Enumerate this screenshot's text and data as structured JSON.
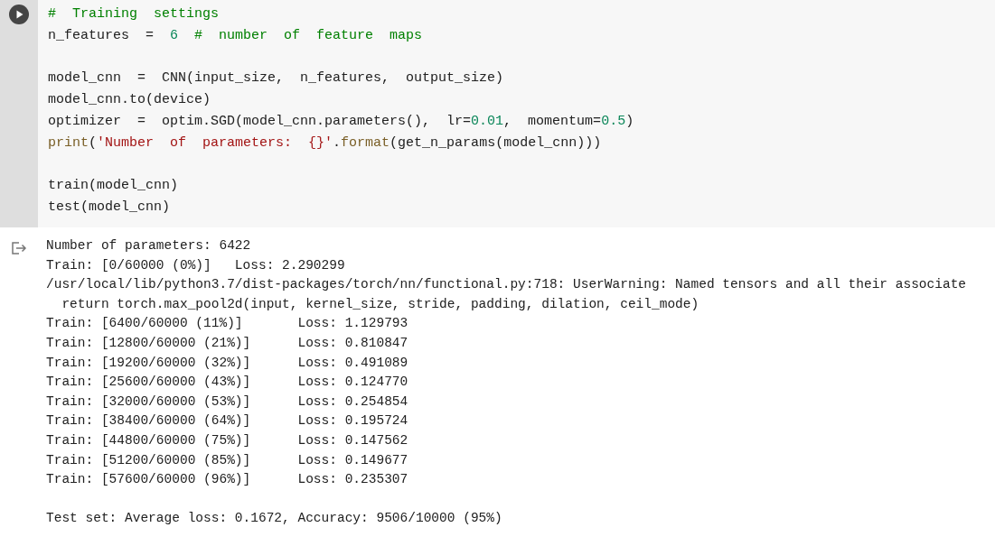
{
  "code_cell": {
    "blocks": [
      [
        [
          {
            "kind": "comment",
            "text": "#  Training  settings"
          }
        ],
        [
          {
            "kind": "plain",
            "text": "n_features  =  "
          },
          {
            "kind": "number",
            "text": "6"
          },
          {
            "kind": "comment",
            "text": "  #  number  of  feature  maps"
          }
        ]
      ],
      [
        [
          {
            "kind": "plain",
            "text": "model_cnn  =  CNN(input_size,  n_features,  output_size)"
          }
        ],
        [
          {
            "kind": "plain",
            "text": "model_cnn.to(device)"
          }
        ],
        [
          {
            "kind": "plain",
            "text": "optimizer  =  optim.SGD(model_cnn.parameters(),  lr="
          },
          {
            "kind": "number",
            "text": "0.01"
          },
          {
            "kind": "plain",
            "text": ",  momentum="
          },
          {
            "kind": "number",
            "text": "0.5"
          },
          {
            "kind": "plain",
            "text": ")"
          }
        ],
        [
          {
            "kind": "builtin",
            "text": "print"
          },
          {
            "kind": "plain",
            "text": "("
          },
          {
            "kind": "string",
            "text": "'Number  of  parameters:  {}'"
          },
          {
            "kind": "plain",
            "text": "."
          },
          {
            "kind": "builtin",
            "text": "format"
          },
          {
            "kind": "plain",
            "text": "(get_n_params(model_cnn)))"
          }
        ]
      ],
      [
        [
          {
            "kind": "plain",
            "text": "train(model_cnn)"
          }
        ],
        [
          {
            "kind": "plain",
            "text": "test(model_cnn)"
          }
        ]
      ]
    ]
  },
  "output": {
    "blocks": [
      [
        "Number of parameters: 6422",
        "Train: [0/60000 (0%)]\tLoss: 2.290299",
        "/usr/local/lib/python3.7/dist-packages/torch/nn/functional.py:718: UserWarning: Named tensors and all their associate",
        "  return torch.max_pool2d(input, kernel_size, stride, padding, dilation, ceil_mode)",
        "Train: [6400/60000 (11%)]\tLoss: 1.129793",
        "Train: [12800/60000 (21%)]\tLoss: 0.810847",
        "Train: [19200/60000 (32%)]\tLoss: 0.491089",
        "Train: [25600/60000 (43%)]\tLoss: 0.124770",
        "Train: [32000/60000 (53%)]\tLoss: 0.254854",
        "Train: [38400/60000 (64%)]\tLoss: 0.195724",
        "Train: [44800/60000 (75%)]\tLoss: 0.147562",
        "Train: [51200/60000 (85%)]\tLoss: 0.149677",
        "Train: [57600/60000 (96%)]\tLoss: 0.235307"
      ],
      [
        "Test set: Average loss: 0.1672, Accuracy: 9506/10000 (95%)"
      ]
    ]
  }
}
